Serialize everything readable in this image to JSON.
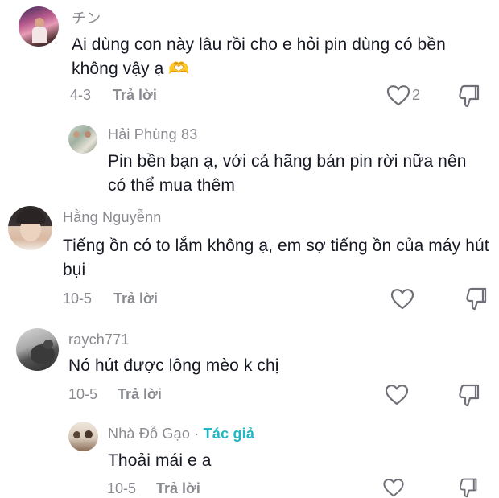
{
  "comments": [
    {
      "username": "チン",
      "text": "Ai dùng con này lâu rồi cho e hỏi pin dùng có bền không vậy ạ 🫶",
      "date": "4-3",
      "reply_label": "Trả lời",
      "likes": "2"
    },
    {
      "username": "Hải Phùng 83",
      "text": "Pin bền bạn ạ, với cả hãng bán pin rời nữa nên có thể mua thêm",
      "is_reply": true
    },
    {
      "username": "Hằng Nguyễnn",
      "text": "Tiếng ồn có to lắm không ạ, em sợ tiếng ồn của máy hút bụi",
      "date": "10-5",
      "reply_label": "Trả lời"
    },
    {
      "username": "raych771",
      "text": "Nó hút được lông mèo k chị",
      "date": "10-5",
      "reply_label": "Trả lời"
    },
    {
      "username": "Nhà Đỗ Gạo",
      "separator": "·",
      "author_badge": "Tác giả",
      "text": "Thoải mái e a",
      "date": "10-5",
      "reply_label": "Trả lời",
      "is_reply": true
    }
  ],
  "icons": {
    "like": "heart-outline-icon",
    "dislike": "thumbs-down-icon"
  },
  "colors": {
    "text": "#161823",
    "muted": "#8a8b91",
    "author_badge": "#20b8c4"
  }
}
